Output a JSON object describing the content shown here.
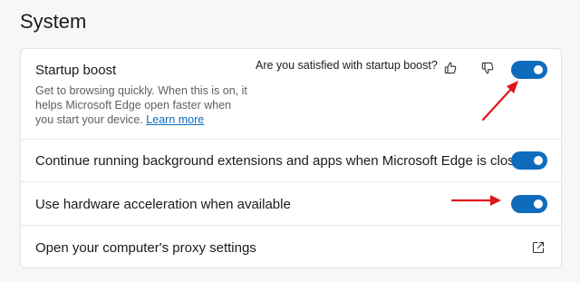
{
  "section": {
    "title": "System"
  },
  "startup_boost": {
    "title": "Startup boost",
    "description": "Get to browsing quickly. When this is on, it helps Microsoft Edge open faster when you start your device.",
    "learn_more": "Learn more",
    "feedback_question": "Are you satisfied with startup boost?",
    "thumbs_up_icon": "thumbs-up-icon",
    "thumbs_down_icon": "thumbs-down-icon",
    "enabled": true
  },
  "background_apps": {
    "title": "Continue running background extensions and apps when Microsoft Edge is closed",
    "enabled": true
  },
  "hardware_acceleration": {
    "title": "Use hardware acceleration when available",
    "enabled": true
  },
  "proxy_settings": {
    "title": "Open your computer's proxy settings",
    "icon": "external-link-icon"
  },
  "colors": {
    "toggle_on": "#0f6cbd",
    "link": "#0f6cbd",
    "annotation_arrow": "#e0141b"
  }
}
